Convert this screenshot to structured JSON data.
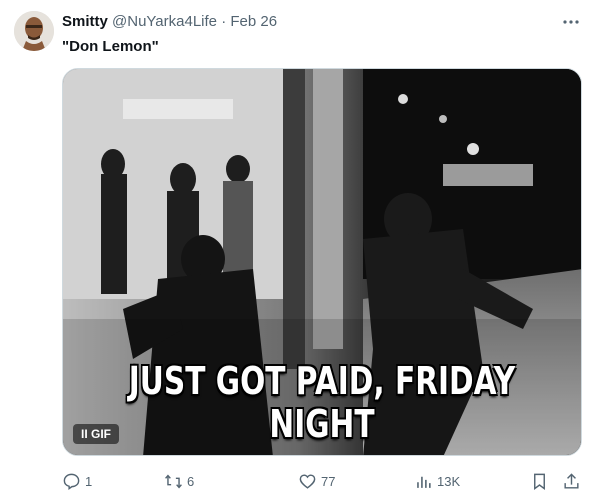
{
  "tweet": {
    "name": "Smitty",
    "handle": "@NuYarka4Life",
    "dot": "·",
    "date": "Feb 26",
    "text": "\"Don Lemon\"",
    "more_icon": "more-icon"
  },
  "media": {
    "caption_line1": "JUST GOT PAID, FRIDAY",
    "caption_line2": "NIGHT",
    "badge_pause": "II",
    "badge_label": "GIF"
  },
  "actions": {
    "replies": "1",
    "reposts": "6",
    "likes": "77",
    "views": "13K"
  },
  "colors": {
    "text": "#0f1419",
    "muted": "#536471",
    "border": "#cfd9de"
  }
}
